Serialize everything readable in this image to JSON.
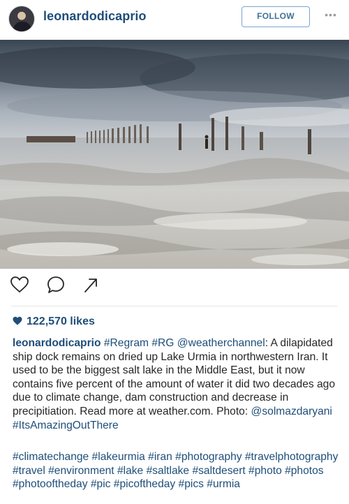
{
  "post": {
    "username": "leonardodicaprio",
    "follow_label": "FOLLOW",
    "more_label": "•••",
    "likes": "122,570 likes",
    "caption": {
      "username": "leonardodicaprio",
      "segments": [
        {
          "text": " ",
          "type": "text"
        },
        {
          "text": "#Regram",
          "type": "tag"
        },
        {
          "text": " ",
          "type": "text"
        },
        {
          "text": "#RG",
          "type": "tag"
        },
        {
          "text": " ",
          "type": "text"
        },
        {
          "text": "@weatherchannel",
          "type": "tag"
        },
        {
          "text": ": A dilapidated ship dock remains on dried up Lake Urmia in northwestern Iran. It used to be the biggest salt lake in the Middle East, but it now contains five percent of the amount of water it did two decades ago due to climate change, dam construction and decrease in precipitiation. Read more at weather.com. Photo: ",
          "type": "text"
        },
        {
          "text": "@solmazdaryani",
          "type": "tag"
        },
        {
          "text": " ",
          "type": "text"
        },
        {
          "text": "#ItsAmazingOutThere",
          "type": "tag"
        }
      ]
    },
    "hashtags": "#climatechange #lakeurmia #iran #photography #travelphotography #travel #environment #lake #saltlake #saltdesert #photo #photos #photooftheday #pic #picoftheday #pics #urmia"
  },
  "icons": {
    "like": "heart-outline-icon",
    "comment": "comment-bubble-icon",
    "share": "share-arrow-icon",
    "likes_heart": "heart-filled-icon"
  },
  "colors": {
    "link": "#1e4e79",
    "follow_border": "#7aa5cf",
    "follow_text": "#3f729b"
  }
}
